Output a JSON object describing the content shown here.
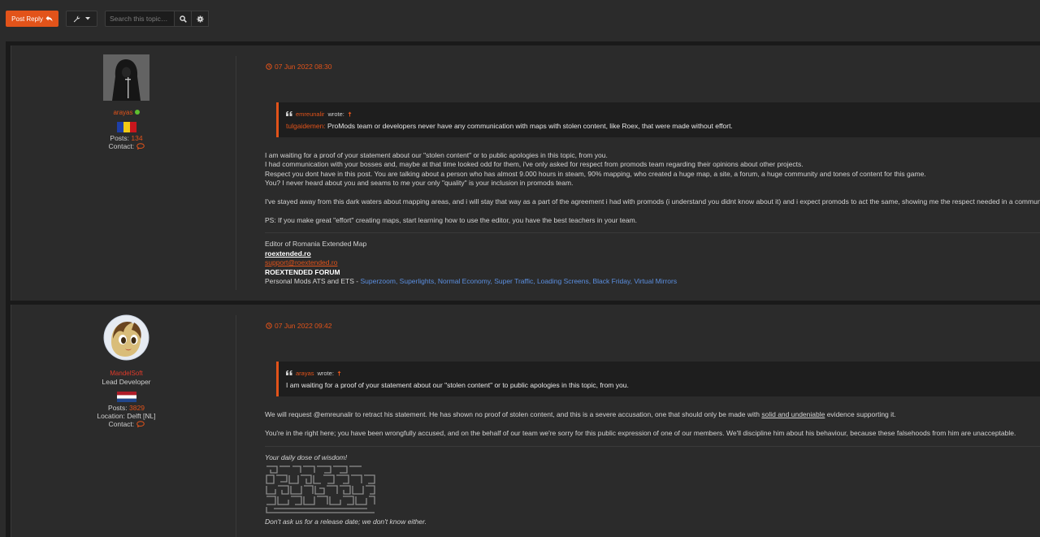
{
  "toolbar": {
    "post_reply_label": "Post Reply",
    "search_placeholder": "Search this topic…"
  },
  "posts": [
    {
      "author": {
        "name": "arayas",
        "rank": "",
        "posts_label": "Posts:",
        "posts_count": "134",
        "location_label": "",
        "location": "",
        "contact_label": "Contact:"
      },
      "date": "07 Jun 2022 08:30",
      "quote": {
        "author": "emreunalir",
        "wrote": "wrote:",
        "mention": "tulgaidemen:",
        "text": " ProMods team or developers never have any communication with maps with stolen content, like Roex, that were made without effort."
      },
      "paragraphs": [
        "I am waiting for a proof of your statement about our \"stolen content\" or to public apologies in this topic, from you.",
        "I had communication with your bosses and, maybe at that time looked odd for them, i've only asked for respect from promods team regarding their opinions about other projects.",
        "Respect you dont have in this post. You are talking about a person who has almost 9.000 hours in steam, 90% mapping, who created a huge map, a site, a forum, a huge community and tones of content for this game.",
        "You? I never heard about you and seams to me your only \"quality\" is your inclusion in promods team.",
        "I've stayed away from this dark waters about mapping areas, and i will stay that way as a part of the agreement i had with promods (i understand you didnt know about it) and i expect promods to act the same, showing me the respect needed in a community.",
        "PS: If you make great \"effort\" creating maps, start learning how to use the editor, you have the best teachers in your team."
      ],
      "signature": {
        "line1": "Editor of Romania Extended Map",
        "site": "roextended.ro",
        "email": "support@roextended.ro",
        "forum": "ROEXTENDED FORUM",
        "mods_prefix": "Personal Mods ATS and ETS - ",
        "mods": "Superzoom, Superlights, Normal Economy, Super Traffic, Loading Screens, Black Friday, Virtual Mirrors"
      }
    },
    {
      "author": {
        "name": "MandelSoft",
        "rank": "Lead Developer",
        "posts_label": "Posts:",
        "posts_count": "3829",
        "location_label": "Location:",
        "location": "Delft [NL]",
        "contact_label": "Contact:"
      },
      "date": "07 Jun 2022 09:42",
      "quote": {
        "author": "arayas",
        "wrote": "wrote:",
        "text": "I am waiting for a proof of your statement about our \"stolen content\" or to public apologies in this topic, from you."
      },
      "p1_before": "We will request @emreunalir to retract his statement. He has shown no proof of stolen content, and this is a severe accusation, one that should only be made with ",
      "p1_underlined": "solid and undeniable",
      "p1_after": " evidence supporting it.",
      "p2": "You're in the right here; you have been wrongfully accused, and on the behalf of our team we're sorry for this public expression of one of our members. We'll discipline him about his behaviour, because these falsehoods from him are unacceptable.",
      "signature": {
        "top": "Your daily dose of wisdom!",
        "bottom": "Don't ask us for a release date; we don't know either."
      }
    }
  ],
  "colors": {
    "accent": "#e2531a",
    "link_blue": "#5b8fe0",
    "online": "#5fbf2f"
  }
}
